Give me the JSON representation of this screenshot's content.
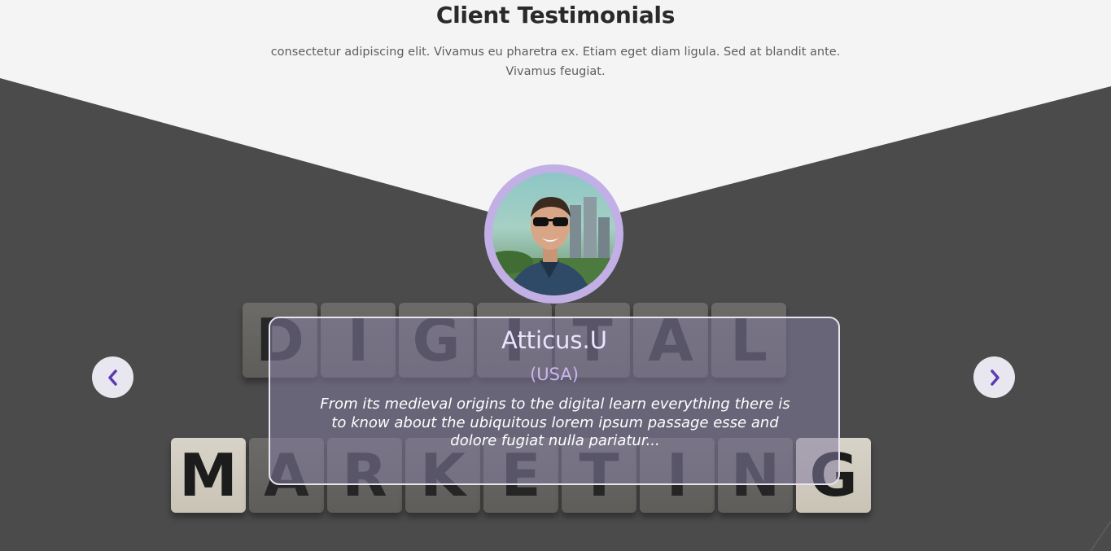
{
  "section": {
    "title": "Client Testimonials",
    "subtitle": "consectetur adipiscing elit. Vivamus eu pharetra ex. Etiam eget diam ligula. Sed at blandit ante. Vivamus feugiat."
  },
  "background": {
    "tiles_top": [
      "D",
      "I",
      "G",
      "I",
      "T",
      "A",
      "L"
    ],
    "tiles_bottom": [
      "M",
      "A",
      "R",
      "K",
      "E",
      "T",
      "I",
      "N",
      "G"
    ]
  },
  "testimonial": {
    "name": "Atticus.U",
    "country": "(USA)",
    "quote": "From its medieval origins to the digital learn everything there is to know about the ubiquitous lorem ipsum passage esse and dolore fugiat nulla pariatur..."
  },
  "carousel": {
    "prev_icon": "chevron-left-icon",
    "next_icon": "chevron-right-icon"
  },
  "colors": {
    "accent": "#5c3ab3",
    "avatar_ring": "#c1afe6",
    "dark_band": "#4b4b4b",
    "page_bg": "#f4f4f4"
  }
}
